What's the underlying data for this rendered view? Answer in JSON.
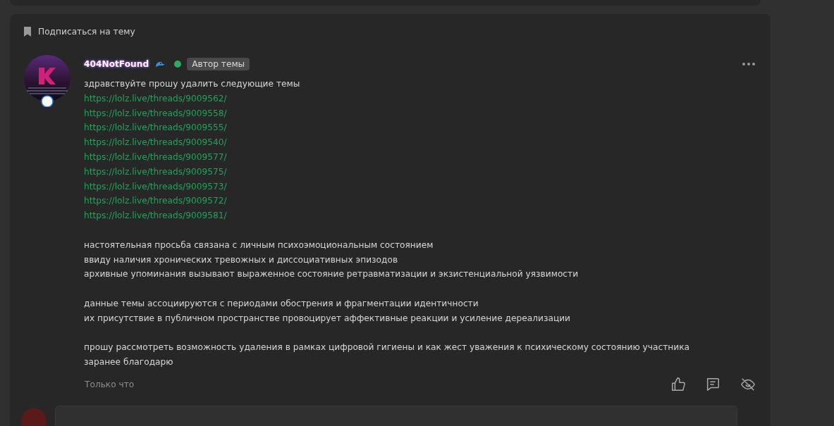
{
  "subscribe": {
    "label": "Подписаться на тему"
  },
  "post": {
    "author": "404NotFound",
    "online": true,
    "badge": "Автор темы",
    "intro": "здравствуйте прошу удалить следующие темы",
    "links": [
      "https://lolz.live/threads/9009562/",
      "https://lolz.live/threads/9009558/",
      "https://lolz.live/threads/9009555/",
      "https://lolz.live/threads/9009540/",
      "https://lolz.live/threads/9009577/",
      "https://lolz.live/threads/9009575/",
      "https://lolz.live/threads/9009573/",
      "https://lolz.live/threads/9009572/",
      "https://lolz.live/threads/9009581/"
    ],
    "paragraphs": [
      [
        "настоятельная просьба связана с личным психоэмоциональным состоянием",
        "ввиду наличия хронических тревожных и диссоциативных эпизодов",
        "архивные упоминания вызывают выраженное состояние ретравматизации и экзистенциальной уязвимости"
      ],
      [
        "данные темы ассоциируются с периодами обострения и фрагментации идентичности",
        "их присутствие в публичном пространстве провоцирует аффективные реакции и усиление дереализации"
      ],
      [
        "прошу рассмотреть возможность удаления в рамках цифровой гигиены и как жест уважения к психическому состоянию участника",
        "заранее благодарю"
      ]
    ],
    "time": "Только что"
  }
}
